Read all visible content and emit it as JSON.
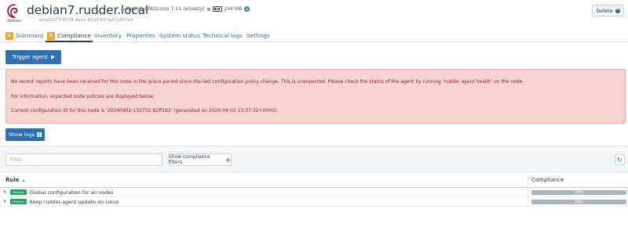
{
  "header": {
    "os_name": "debian",
    "title": "debian7.rudder.local",
    "os_version": "Debian GNU/Linux 7.11 (wheezy)",
    "ram": "244 MB",
    "node_id": "e0ad5273-6078-4e5e-85d0-427ad72497b9",
    "delete_label": "Delete"
  },
  "tabs": [
    {
      "label": "Summary",
      "badge": "E"
    },
    {
      "label": "Compliance",
      "badge": "E"
    },
    {
      "label": "Inventory"
    },
    {
      "label": "Properties"
    },
    {
      "label": "System status"
    },
    {
      "label": "Technical logs"
    },
    {
      "label": "Settings"
    }
  ],
  "trigger_label": "Trigger agent",
  "alert": {
    "line1": "No recent reports have been received for this node in the grace period since the last configuration policy change. This is unexpected. Please check the status of the agent by running 'rudder agent health' on the node.",
    "line2": "For information, expected node policies are displayed below.",
    "line3": "Current configuration ID for this node is '20240402-133732-82ff192' (generated on 2024-04-02 13:37:32+0000)."
  },
  "show_logs_label": "Show logs",
  "filter": {
    "placeholder": "Filter",
    "compliance_filters_label": "Show compliance filters"
  },
  "table": {
    "headers": {
      "rule": "Rule",
      "compliance": "Compliance"
    },
    "rows": [
      {
        "badge": "Enforce",
        "name": "Global configuration for all nodes",
        "compliance": "100%"
      },
      {
        "badge": "Enforce",
        "name": "Keep rudder-agent update on Linux",
        "compliance": "100%"
      }
    ]
  },
  "colors": {
    "primary": "#2f6fb2",
    "badge_orange": "#f0a22b",
    "alert_bg": "#f7d4d2",
    "alert_text": "#8e2722",
    "enforce_green": "#22a45e",
    "bar_gray": "#a9b4bd"
  }
}
